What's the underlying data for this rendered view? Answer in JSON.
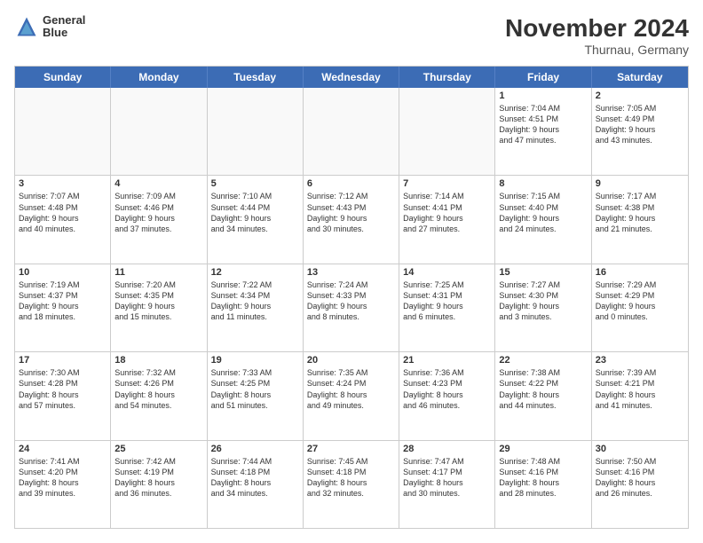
{
  "header": {
    "logo_line1": "General",
    "logo_line2": "Blue",
    "month_title": "November 2024",
    "location": "Thurnau, Germany"
  },
  "days_of_week": [
    "Sunday",
    "Monday",
    "Tuesday",
    "Wednesday",
    "Thursday",
    "Friday",
    "Saturday"
  ],
  "weeks": [
    [
      {
        "day": "",
        "empty": true,
        "lines": []
      },
      {
        "day": "",
        "empty": true,
        "lines": []
      },
      {
        "day": "",
        "empty": true,
        "lines": []
      },
      {
        "day": "",
        "empty": true,
        "lines": []
      },
      {
        "day": "",
        "empty": true,
        "lines": []
      },
      {
        "day": "1",
        "empty": false,
        "lines": [
          "Sunrise: 7:04 AM",
          "Sunset: 4:51 PM",
          "Daylight: 9 hours",
          "and 47 minutes."
        ]
      },
      {
        "day": "2",
        "empty": false,
        "lines": [
          "Sunrise: 7:05 AM",
          "Sunset: 4:49 PM",
          "Daylight: 9 hours",
          "and 43 minutes."
        ]
      }
    ],
    [
      {
        "day": "3",
        "empty": false,
        "lines": [
          "Sunrise: 7:07 AM",
          "Sunset: 4:48 PM",
          "Daylight: 9 hours",
          "and 40 minutes."
        ]
      },
      {
        "day": "4",
        "empty": false,
        "lines": [
          "Sunrise: 7:09 AM",
          "Sunset: 4:46 PM",
          "Daylight: 9 hours",
          "and 37 minutes."
        ]
      },
      {
        "day": "5",
        "empty": false,
        "lines": [
          "Sunrise: 7:10 AM",
          "Sunset: 4:44 PM",
          "Daylight: 9 hours",
          "and 34 minutes."
        ]
      },
      {
        "day": "6",
        "empty": false,
        "lines": [
          "Sunrise: 7:12 AM",
          "Sunset: 4:43 PM",
          "Daylight: 9 hours",
          "and 30 minutes."
        ]
      },
      {
        "day": "7",
        "empty": false,
        "lines": [
          "Sunrise: 7:14 AM",
          "Sunset: 4:41 PM",
          "Daylight: 9 hours",
          "and 27 minutes."
        ]
      },
      {
        "day": "8",
        "empty": false,
        "lines": [
          "Sunrise: 7:15 AM",
          "Sunset: 4:40 PM",
          "Daylight: 9 hours",
          "and 24 minutes."
        ]
      },
      {
        "day": "9",
        "empty": false,
        "lines": [
          "Sunrise: 7:17 AM",
          "Sunset: 4:38 PM",
          "Daylight: 9 hours",
          "and 21 minutes."
        ]
      }
    ],
    [
      {
        "day": "10",
        "empty": false,
        "lines": [
          "Sunrise: 7:19 AM",
          "Sunset: 4:37 PM",
          "Daylight: 9 hours",
          "and 18 minutes."
        ]
      },
      {
        "day": "11",
        "empty": false,
        "lines": [
          "Sunrise: 7:20 AM",
          "Sunset: 4:35 PM",
          "Daylight: 9 hours",
          "and 15 minutes."
        ]
      },
      {
        "day": "12",
        "empty": false,
        "lines": [
          "Sunrise: 7:22 AM",
          "Sunset: 4:34 PM",
          "Daylight: 9 hours",
          "and 11 minutes."
        ]
      },
      {
        "day": "13",
        "empty": false,
        "lines": [
          "Sunrise: 7:24 AM",
          "Sunset: 4:33 PM",
          "Daylight: 9 hours",
          "and 8 minutes."
        ]
      },
      {
        "day": "14",
        "empty": false,
        "lines": [
          "Sunrise: 7:25 AM",
          "Sunset: 4:31 PM",
          "Daylight: 9 hours",
          "and 6 minutes."
        ]
      },
      {
        "day": "15",
        "empty": false,
        "lines": [
          "Sunrise: 7:27 AM",
          "Sunset: 4:30 PM",
          "Daylight: 9 hours",
          "and 3 minutes."
        ]
      },
      {
        "day": "16",
        "empty": false,
        "lines": [
          "Sunrise: 7:29 AM",
          "Sunset: 4:29 PM",
          "Daylight: 9 hours",
          "and 0 minutes."
        ]
      }
    ],
    [
      {
        "day": "17",
        "empty": false,
        "lines": [
          "Sunrise: 7:30 AM",
          "Sunset: 4:28 PM",
          "Daylight: 8 hours",
          "and 57 minutes."
        ]
      },
      {
        "day": "18",
        "empty": false,
        "lines": [
          "Sunrise: 7:32 AM",
          "Sunset: 4:26 PM",
          "Daylight: 8 hours",
          "and 54 minutes."
        ]
      },
      {
        "day": "19",
        "empty": false,
        "lines": [
          "Sunrise: 7:33 AM",
          "Sunset: 4:25 PM",
          "Daylight: 8 hours",
          "and 51 minutes."
        ]
      },
      {
        "day": "20",
        "empty": false,
        "lines": [
          "Sunrise: 7:35 AM",
          "Sunset: 4:24 PM",
          "Daylight: 8 hours",
          "and 49 minutes."
        ]
      },
      {
        "day": "21",
        "empty": false,
        "lines": [
          "Sunrise: 7:36 AM",
          "Sunset: 4:23 PM",
          "Daylight: 8 hours",
          "and 46 minutes."
        ]
      },
      {
        "day": "22",
        "empty": false,
        "lines": [
          "Sunrise: 7:38 AM",
          "Sunset: 4:22 PM",
          "Daylight: 8 hours",
          "and 44 minutes."
        ]
      },
      {
        "day": "23",
        "empty": false,
        "lines": [
          "Sunrise: 7:39 AM",
          "Sunset: 4:21 PM",
          "Daylight: 8 hours",
          "and 41 minutes."
        ]
      }
    ],
    [
      {
        "day": "24",
        "empty": false,
        "lines": [
          "Sunrise: 7:41 AM",
          "Sunset: 4:20 PM",
          "Daylight: 8 hours",
          "and 39 minutes."
        ]
      },
      {
        "day": "25",
        "empty": false,
        "lines": [
          "Sunrise: 7:42 AM",
          "Sunset: 4:19 PM",
          "Daylight: 8 hours",
          "and 36 minutes."
        ]
      },
      {
        "day": "26",
        "empty": false,
        "lines": [
          "Sunrise: 7:44 AM",
          "Sunset: 4:18 PM",
          "Daylight: 8 hours",
          "and 34 minutes."
        ]
      },
      {
        "day": "27",
        "empty": false,
        "lines": [
          "Sunrise: 7:45 AM",
          "Sunset: 4:18 PM",
          "Daylight: 8 hours",
          "and 32 minutes."
        ]
      },
      {
        "day": "28",
        "empty": false,
        "lines": [
          "Sunrise: 7:47 AM",
          "Sunset: 4:17 PM",
          "Daylight: 8 hours",
          "and 30 minutes."
        ]
      },
      {
        "day": "29",
        "empty": false,
        "lines": [
          "Sunrise: 7:48 AM",
          "Sunset: 4:16 PM",
          "Daylight: 8 hours",
          "and 28 minutes."
        ]
      },
      {
        "day": "30",
        "empty": false,
        "lines": [
          "Sunrise: 7:50 AM",
          "Sunset: 4:16 PM",
          "Daylight: 8 hours",
          "and 26 minutes."
        ]
      }
    ]
  ]
}
